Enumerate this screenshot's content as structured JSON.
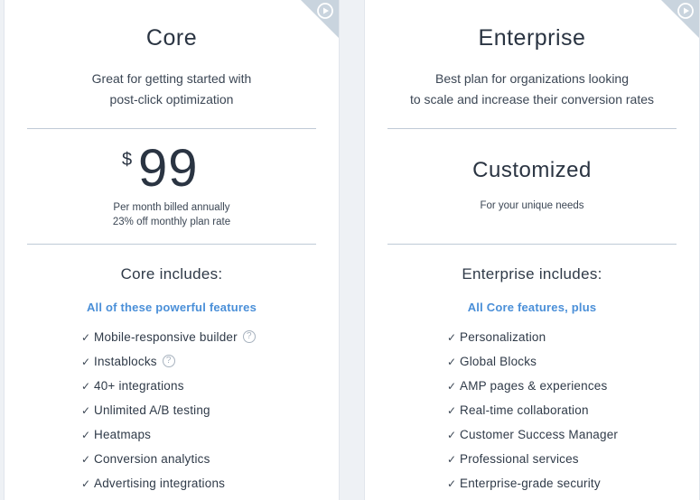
{
  "colors": {
    "accent": "#4a8fd8",
    "corner": "#c9d4de",
    "text": "#2f3a48"
  },
  "core": {
    "name": "Core",
    "desc_line1": "Great for getting started with",
    "desc_line2": "post-click optimization",
    "price_currency": "$",
    "price_amount": "99",
    "price_note1": "Per month billed annually",
    "price_note2": "23% off monthly plan rate",
    "includes_title": "Core includes:",
    "includes_sub": "All of these powerful features",
    "features": [
      {
        "label": "Mobile-responsive builder",
        "help": "?"
      },
      {
        "label": "Instablocks",
        "help": "?"
      },
      {
        "label": "40+ integrations"
      },
      {
        "label": "Unlimited A/B testing"
      },
      {
        "label": "Heatmaps"
      },
      {
        "label": "Conversion analytics"
      },
      {
        "label": "Advertising integrations"
      }
    ]
  },
  "enterprise": {
    "name": "Enterprise",
    "desc_line1": "Best plan for organizations looking",
    "desc_line2": "to scale and increase their conversion rates",
    "price_label": "Customized",
    "price_note": "For your unique needs",
    "includes_title": "Enterprise includes:",
    "includes_sub": "All Core features, plus",
    "features": [
      {
        "label": "Personalization"
      },
      {
        "label": "Global Blocks"
      },
      {
        "label": "AMP pages & experiences"
      },
      {
        "label": "Real-time collaboration"
      },
      {
        "label": "Customer Success Manager"
      },
      {
        "label": "Professional services"
      },
      {
        "label": "Enterprise-grade security"
      }
    ]
  }
}
